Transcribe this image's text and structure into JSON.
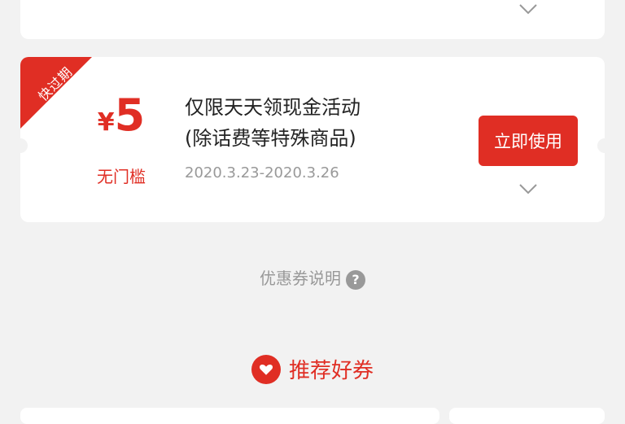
{
  "coupon": {
    "badge": "快过期",
    "currency": "¥",
    "amount": "5",
    "condition": "无门槛",
    "title_line1": "仅限天天领现金活动",
    "title_line2": "(除话费等特殊商品)",
    "date_range": "2020.3.23-2020.3.26",
    "use_button": "立即使用"
  },
  "explain": {
    "label": "优惠券说明",
    "icon_text": "?"
  },
  "recommend": {
    "label": "推荐好券"
  },
  "colors": {
    "accent": "#e02e24",
    "muted": "#999999",
    "background": "#f2f2f2"
  },
  "icons": [
    "chevron-down-icon",
    "question-icon",
    "heart-icon"
  ]
}
